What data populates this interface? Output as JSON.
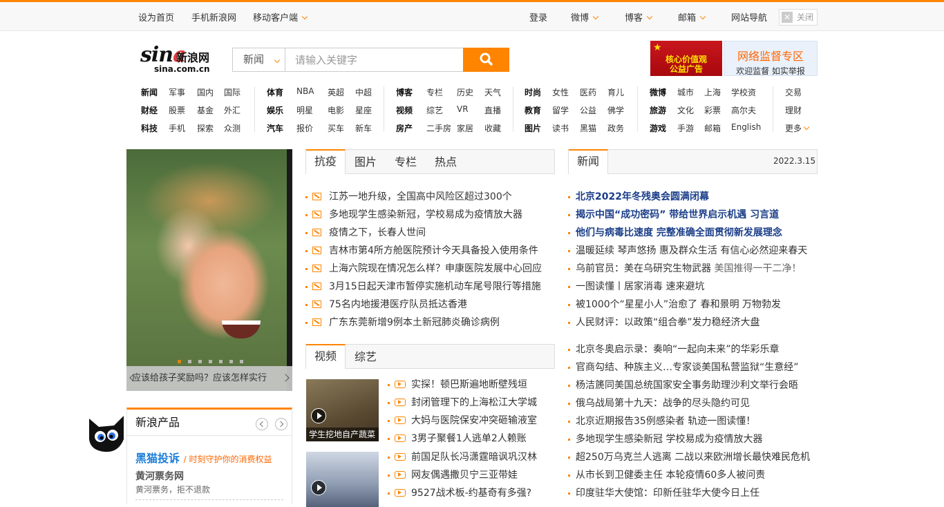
{
  "topbar": {
    "left": [
      "设为首页",
      "手机新浪网",
      "移动客户端"
    ],
    "right": [
      "登录",
      "微博",
      "博客",
      "邮箱",
      "网站导航"
    ],
    "close_label": "关闭"
  },
  "logo": {
    "brand": "sina",
    "cn": "新浪网",
    "domain": "sina.com.cn"
  },
  "search": {
    "category": "新闻",
    "placeholder": "请输入关键字"
  },
  "ads": {
    "left_line1": "核心价值观",
    "left_line2": "公益广告",
    "right_title": "网络监督专区",
    "right_sub": "欢迎监督 如实举报"
  },
  "nav": [
    [
      "新闻",
      "军事",
      "国内",
      "国际"
    ],
    [
      "财经",
      "股票",
      "基金",
      "外汇"
    ],
    [
      "科技",
      "手机",
      "探索",
      "众测"
    ],
    [
      "体育",
      "NBA",
      "英超",
      "中超"
    ],
    [
      "娱乐",
      "明星",
      "电影",
      "星座"
    ],
    [
      "汽车",
      "报价",
      "买车",
      "新车"
    ],
    [
      "博客",
      "专栏",
      "历史",
      "天气"
    ],
    [
      "视频",
      "综艺",
      "VR",
      "直播"
    ],
    [
      "房产",
      "二手房",
      "家居",
      "收藏"
    ],
    [
      "时尚",
      "女性",
      "医药",
      "育儿"
    ],
    [
      "教育",
      "留学",
      "公益",
      "佛学"
    ],
    [
      "图片",
      "读书",
      "黑猫",
      "政务"
    ],
    [
      "微博",
      "城市",
      "上海",
      "学校资"
    ],
    [
      "旅游",
      "文化",
      "彩票",
      "高尔夫"
    ],
    [
      "游戏",
      "手游",
      "邮箱",
      "English"
    ],
    [
      "交易"
    ],
    [
      "理财"
    ],
    [
      "更多"
    ]
  ],
  "slider": {
    "caption": "应该给孩子奖励吗？应该怎样实行",
    "dot_count": 7,
    "active_dot": 0
  },
  "products": {
    "title": "新浪产品",
    "item_name": "黑猫投诉",
    "item_slogan": "/ 时刻守护你的消费权益",
    "sub_title": "黄河票务网",
    "sub_desc": "黄河票务，拒不退款"
  },
  "center": {
    "tabs": [
      "抗疫",
      "图片",
      "专栏",
      "热点"
    ],
    "items": [
      "江苏一地升级，全国高中风险区超过300个",
      "多地现学生感染新冠，学校易成为疫情放大器",
      "疫情之下，长春人世间",
      "吉林市第4所方舱医院预计今天具备投入使用条件",
      "上海六院现在情况怎么样？申康医院发展中心回应",
      "3月15日起天津市暂停实施机动车尾号限行等措施",
      "75名内地援港医疗队员抵达香港",
      "广东东莞新增9例本土新冠肺炎确诊病例"
    ],
    "video_tabs": [
      "视频",
      "综艺"
    ],
    "thumb_caption": "学生挖地自产蔬菜",
    "video_items": [
      "实探！顿巴斯遍地断壁残垣",
      "封闭管理下的上海松江大学城",
      "大妈与医院保安冲突砸输液室",
      "3男子聚餐1人逃单2人赖账",
      "前国足队长冯潇霆暗讽巩汉林",
      "网友偶遇撒贝宁三亚带娃",
      "9527战术板-约基奇有多强?"
    ]
  },
  "news": {
    "tab": "新闻",
    "date": "2022.3.15",
    "headlines": [
      "北京2022年冬残奥会圆满闭幕",
      "揭示中国“成功密码” 带给世界启示机遇 习言道",
      "他们与病毒比速度 完整准确全面贯彻新发展理念"
    ],
    "items": [
      {
        "t": "温暖延续 琴声悠扬 惠及群众生活 有信心必然迎来春天",
        "g": ""
      },
      {
        "t": "乌前官员：美在乌研究生物武器 ",
        "g": "美国推得一干二净！"
      },
      {
        "t": "一图读懂丨居家消毒 速来避坑",
        "g": ""
      },
      {
        "t": "被1000个“星星小人”治愈了 春和景明 万物勃发",
        "g": ""
      },
      {
        "t": "人民财评：以政策“组合拳”发力稳经济大盘",
        "g": ""
      }
    ],
    "items2": [
      "北京冬奥启示录：奏响“一起向未来”的华彩乐章",
      "官商勾结、种族主义…专家谈美国私营监狱“生意经”",
      "杨洁篪同美国总统国家安全事务助理沙利文举行会晤",
      "俄乌战局第十九天：战争的尽头隐约可见",
      "北京近期报告35例感染者 轨迹一图读懂！",
      "多地现学生感染新冠 学校易成为疫情放大器",
      "超250万乌克兰人逃离 二战以来欧洲增长最快难民危机",
      "从市长到卫健委主任 本轮疫情60多人被问责",
      "印度驻华大使馆：印新任驻华大使今日上任"
    ]
  },
  "colors": {
    "accent": "#ff8400",
    "headline": "#1b3e89",
    "link_blue": "#1a7ed8"
  }
}
